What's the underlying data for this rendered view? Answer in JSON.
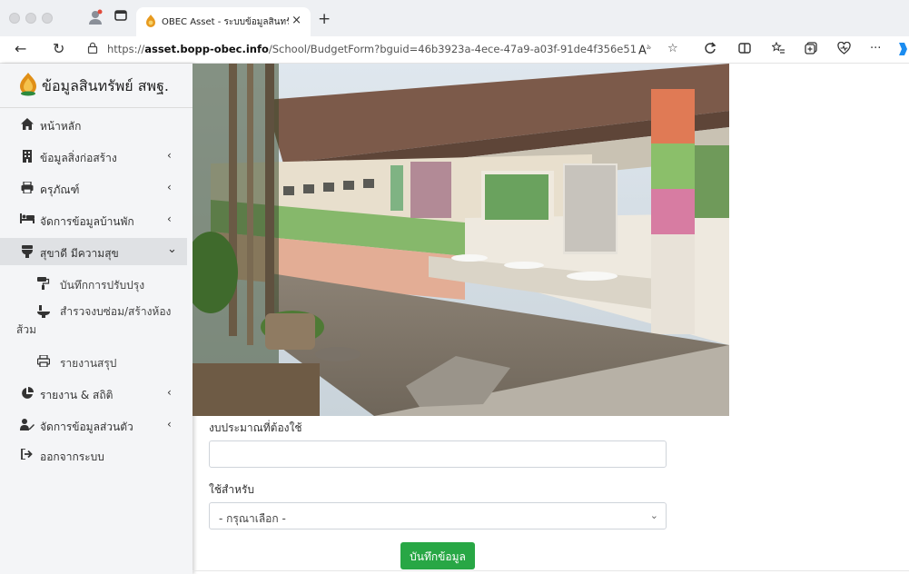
{
  "browser": {
    "tab_title": "OBEC Asset - ระบบข้อมูลสินทรัพ",
    "tab_close": "×",
    "new_tab": "+",
    "url_prefix": "https://",
    "url_host": "asset.bopp-obec.info",
    "url_path": "/School/BudgetForm?bguid=46b3923a-4ece-47a9-a03f-91de4f356e51",
    "more": "···"
  },
  "sidebar": {
    "brand": "ข้อมูลสินทรัพย์ สพฐ.",
    "items": [
      {
        "label": "หน้าหลัก",
        "icon": "home-icon"
      },
      {
        "label": "ข้อมูลสิ่งก่อสร้าง",
        "icon": "building-icon",
        "chevron": "‹"
      },
      {
        "label": "ครุภัณฑ์",
        "icon": "printer-icon",
        "chevron": "‹"
      },
      {
        "label": "จัดการข้อมูลบ้านพัก",
        "icon": "bed-icon",
        "chevron": "‹"
      },
      {
        "label": "สุขาดี มีความสุข",
        "icon": "toilet-icon",
        "chevron": "⌄"
      },
      {
        "label": "บันทึกการปรับปรุง",
        "icon": "paint-roller-icon"
      },
      {
        "label": "สำรวจงบซ่อม/สร้างห้องส้วม",
        "icon": "toilet-survey-icon"
      },
      {
        "label": "รายงานสรุป",
        "icon": "print-icon"
      },
      {
        "label": "รายงาน & สถิติ",
        "icon": "pie-chart-icon",
        "chevron": "‹"
      },
      {
        "label": "จัดการข้อมูลส่วนตัว",
        "icon": "user-edit-icon",
        "chevron": "‹"
      },
      {
        "label": "ออกจากระบบ",
        "icon": "sign-out-icon"
      }
    ]
  },
  "form": {
    "budget_label": "งบประมาณที่ต้องใช้",
    "budget_value": "",
    "use_for_label": "ใช้สำหรับ",
    "use_for_selected": "- กรุณาเลือก -",
    "save_label": "บันทึกข้อมูล"
  },
  "colors": {
    "primary_button": "#28a745",
    "sidebar_bg": "#f4f5f7",
    "active_item_bg": "#dfe1e4"
  }
}
